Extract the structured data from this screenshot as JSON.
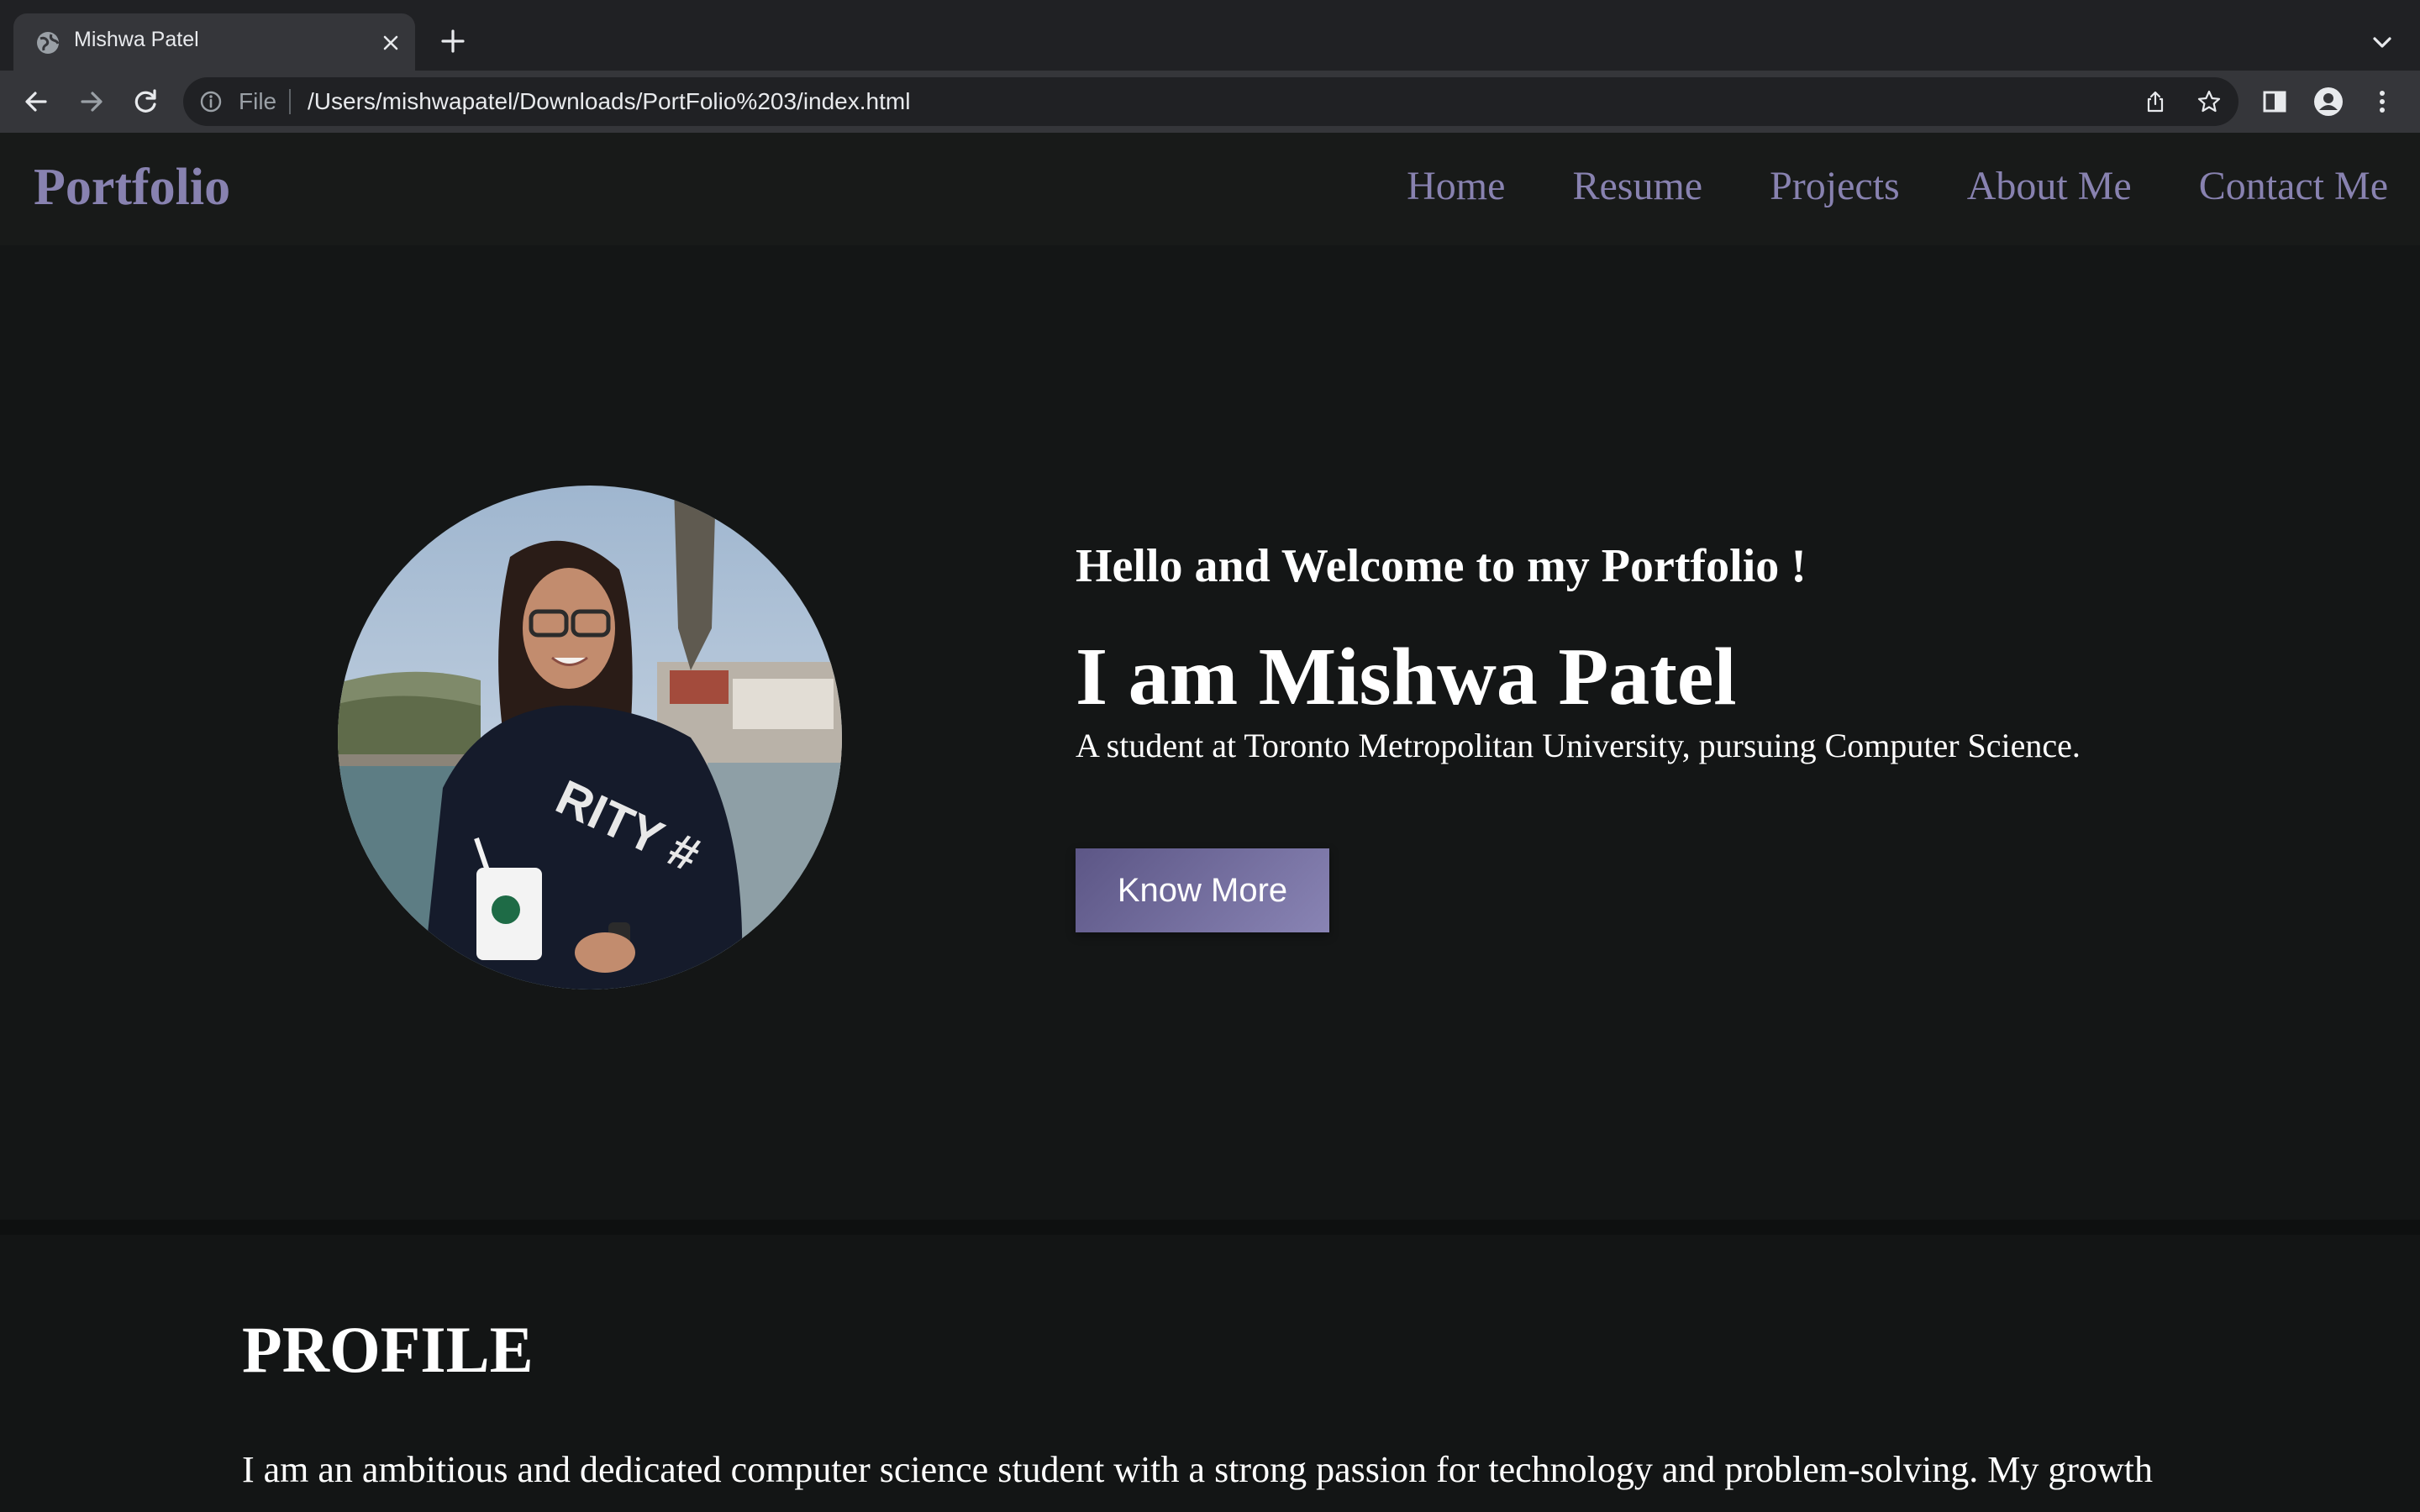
{
  "browser": {
    "tab_title": "Mishwa Patel",
    "scheme_label": "File",
    "url": "/Users/mishwapatel/Downloads/PortFolio%203/index.html",
    "icons": [
      "globe-icon",
      "close-icon",
      "plus-icon",
      "chevron-down-icon",
      "back-arrow-icon",
      "forward-arrow-icon",
      "reload-icon",
      "info-icon",
      "share-icon",
      "star-icon",
      "side-panel-icon",
      "profile-icon",
      "kebab-menu-icon"
    ]
  },
  "site": {
    "logo": "Portfolio",
    "nav": [
      "Home",
      "Resume",
      "Projects",
      "About Me",
      "Contact Me"
    ],
    "accent_color": "#8882b0"
  },
  "hero": {
    "greeting": "Hello and Welcome to my Portfolio !",
    "name": "I am Mishwa Patel",
    "tagline": "A student at Toronto Metropolitan University, pursuing Computer Science.",
    "button_label": "Know More"
  },
  "profile": {
    "title": "PROFILE",
    "text": "I am an ambitious and dedicated computer science student with a strong passion for technology and problem-solving. My growth"
  }
}
